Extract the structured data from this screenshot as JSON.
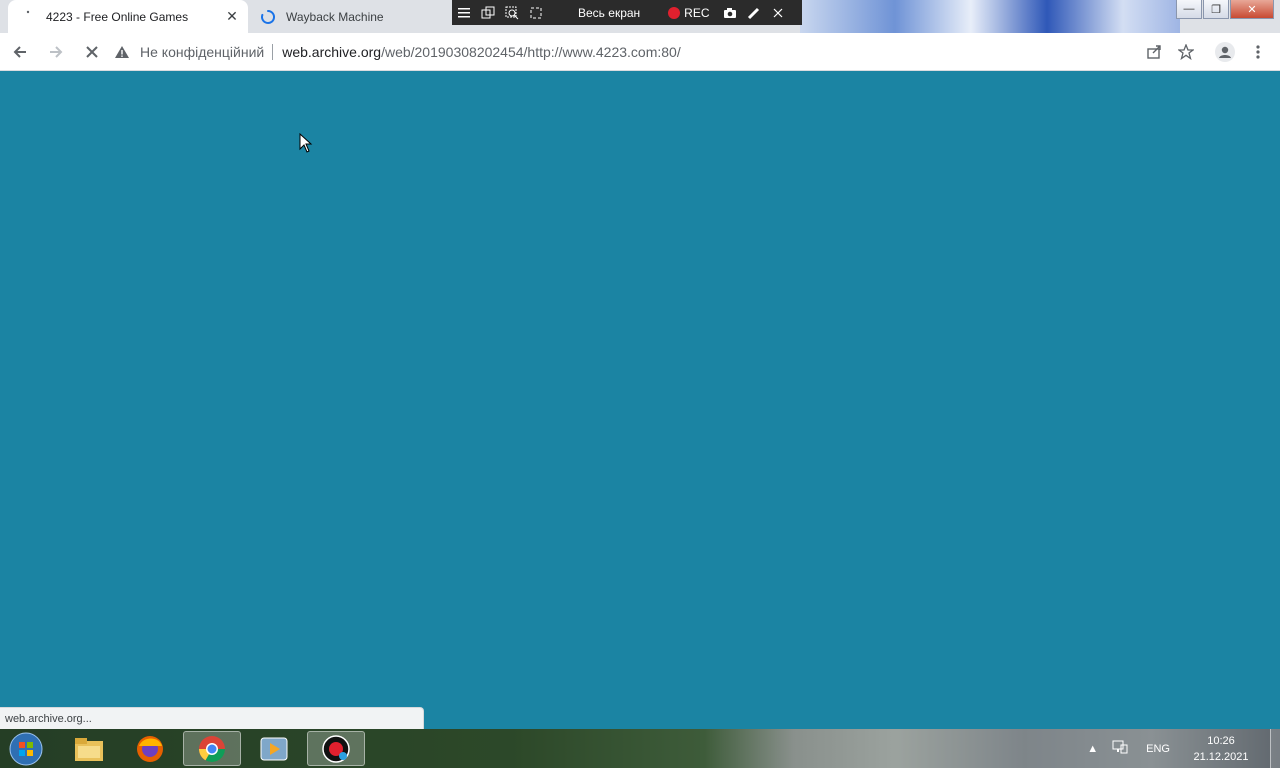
{
  "browser": {
    "tabs": [
      {
        "label": "4223 - Free Online Games",
        "active": true
      },
      {
        "label": "Wayback Machine",
        "active": false
      }
    ],
    "omnibox": {
      "security_label": "Не конфіденційний",
      "url_host": "web.archive.org",
      "url_path": "/web/20190308202454/http://www.4223.com:80/"
    },
    "status_text": "web.archive.org..."
  },
  "recorder": {
    "mode_label": "Весь екран",
    "rec_label": "REC"
  },
  "taskbar": {
    "language": "ENG",
    "time": "10:26",
    "date": "21.12.2021"
  },
  "colors": {
    "page_background": "#1b84a3",
    "rec_dot": "#e0202e"
  }
}
